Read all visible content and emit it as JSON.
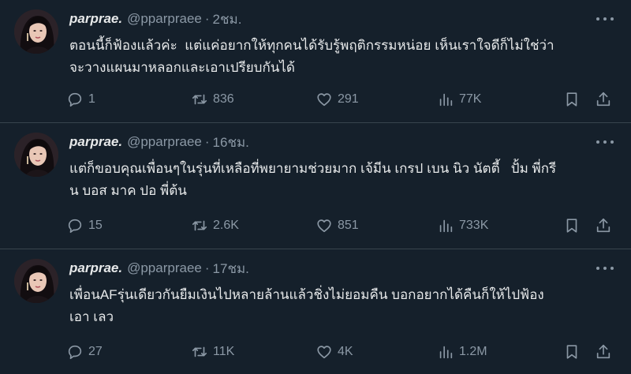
{
  "tweets": [
    {
      "name": "parprae.",
      "handle": "@pparpraee",
      "separator": "·",
      "time": "2ชม.",
      "text": "ตอนนี้ก็ฟ้องแล้วค่ะ  แต่แค่อยากให้ทุกคนได้รับรู้พฤติกรรมหน่อย เห็นเราใจดีก็ไม่ใช่ว่า\nจะวางแผนมาหลอกและเอาเปรียบกันได้",
      "replies": "1",
      "retweets": "836",
      "likes": "291",
      "views": "77K"
    },
    {
      "name": "parprae.",
      "handle": "@pparpraee",
      "separator": "·",
      "time": "16ชม.",
      "text": "แต่ก็ขอบคุณเพื่อนๆในรุ่นที่เหลือที่พยายามช่วยมาก เจ้มีน เกรป เบน นิว นัตตี้   ปั้ม พี่กรี\nน บอส มาค ปอ พี่ต้น",
      "replies": "15",
      "retweets": "2.6K",
      "likes": "851",
      "views": "733K"
    },
    {
      "name": "parprae.",
      "handle": "@pparpraee",
      "separator": "·",
      "time": "17ชม.",
      "text": "เพื่อนAFรุ่นเดียวกันยืมเงินไปหลายล้านแล้วชิ่งไม่ยอมคืน บอกอยากได้คืนก็ให้ไปฟ้อง\nเอา เลว",
      "replies": "27",
      "retweets": "11K",
      "likes": "4K",
      "views": "1.2M"
    }
  ],
  "icons": {
    "reply": "reply-icon",
    "retweet": "retweet-icon",
    "like": "heart-icon",
    "views": "views-icon",
    "bookmark": "bookmark-icon",
    "share": "share-icon",
    "more": "more-icon"
  },
  "colors": {
    "background": "#15202b",
    "text": "#e7e9ea",
    "muted": "#8b98a5",
    "divider": "#38444d"
  }
}
